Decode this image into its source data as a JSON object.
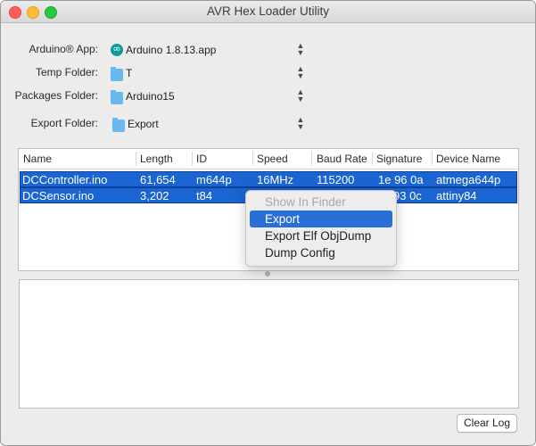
{
  "window": {
    "title": "AVR Hex Loader Utility"
  },
  "form": {
    "arduino_app": {
      "label": "Arduino® App:",
      "value": "Arduino 1.8.13.app",
      "icon": "arduino-app-icon"
    },
    "temp_folder": {
      "label": "Temp Folder:",
      "value": "T",
      "icon": "folder-icon"
    },
    "packages_folder": {
      "label": "Packages Folder:",
      "value": "Arduino15",
      "icon": "folder-icon"
    },
    "export_folder": {
      "label": "Export Folder:",
      "value": "Export",
      "icon": "folder-icon"
    }
  },
  "table": {
    "columns": [
      "Name",
      "Length",
      "ID",
      "Speed",
      "Baud Rate",
      "Signature",
      "Device Name"
    ],
    "rows": [
      {
        "name": "DCController.ino",
        "length": "61,654",
        "id": "m644p",
        "speed": "16MHz",
        "baud": "115200",
        "signature": "1e 96 0a",
        "device": "atmega644p"
      },
      {
        "name": "DCSensor.ino",
        "length": "3,202",
        "id": "t84",
        "speed": "",
        "baud": "",
        "signature": "93 0c",
        "device": "attiny84"
      }
    ]
  },
  "context_menu": {
    "items": [
      {
        "label": "Show In Finder",
        "state": "disabled"
      },
      {
        "label": "Export",
        "state": "selected"
      },
      {
        "label": "Export Elf ObjDump",
        "state": "normal"
      },
      {
        "label": "Dump Config",
        "state": "normal"
      }
    ]
  },
  "buttons": {
    "clear_log": "Clear Log"
  },
  "colors": {
    "selection": "#1a65d2",
    "menu_highlight": "#2a6fd6"
  }
}
